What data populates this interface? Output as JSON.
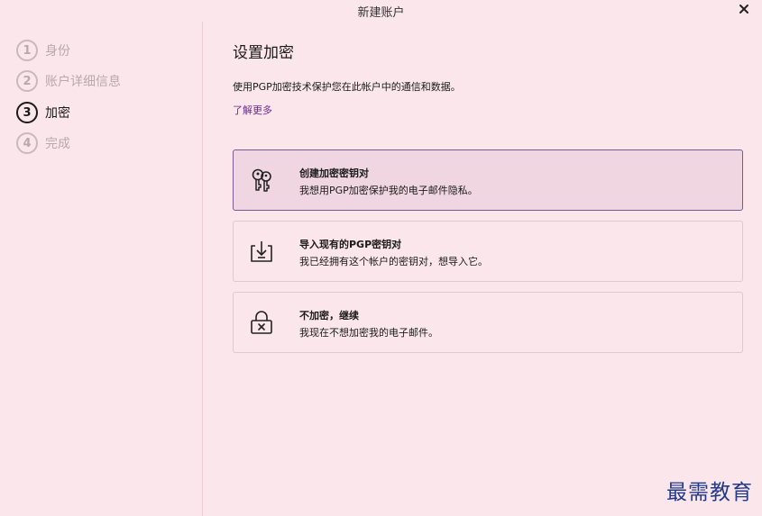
{
  "window": {
    "title": "新建账户",
    "close_icon": "close-icon"
  },
  "steps": [
    {
      "number": "1",
      "label": "身份",
      "state": "inactive"
    },
    {
      "number": "2",
      "label": "账户详细信息",
      "state": "inactive"
    },
    {
      "number": "3",
      "label": "加密",
      "state": "active"
    },
    {
      "number": "4",
      "label": "完成",
      "state": "inactive"
    }
  ],
  "main": {
    "title": "设置加密",
    "description": "使用PGP加密技术保护您在此帐户中的通信和数据。",
    "learn_more": "了解更多",
    "options": [
      {
        "icon": "keys-icon",
        "title": "创建加密密钥对",
        "subtitle": "我想用PGP加密保护我的电子邮件隐私。",
        "selected": true
      },
      {
        "icon": "import-icon",
        "title": "导入现有的PGP密钥对",
        "subtitle": "我已经拥有这个帐户的密钥对，想导入它。",
        "selected": false
      },
      {
        "icon": "unlock-x-icon",
        "title": "不加密，继续",
        "subtitle": "我现在不想加密我的电子邮件。",
        "selected": false
      }
    ]
  },
  "watermark": "最需教育",
  "colors": {
    "background": "#fbe6ec",
    "selected_background": "#f0d6e0",
    "selected_border": "#7a5a8c",
    "link": "#6a2a8a",
    "watermark": "#223a8a"
  }
}
